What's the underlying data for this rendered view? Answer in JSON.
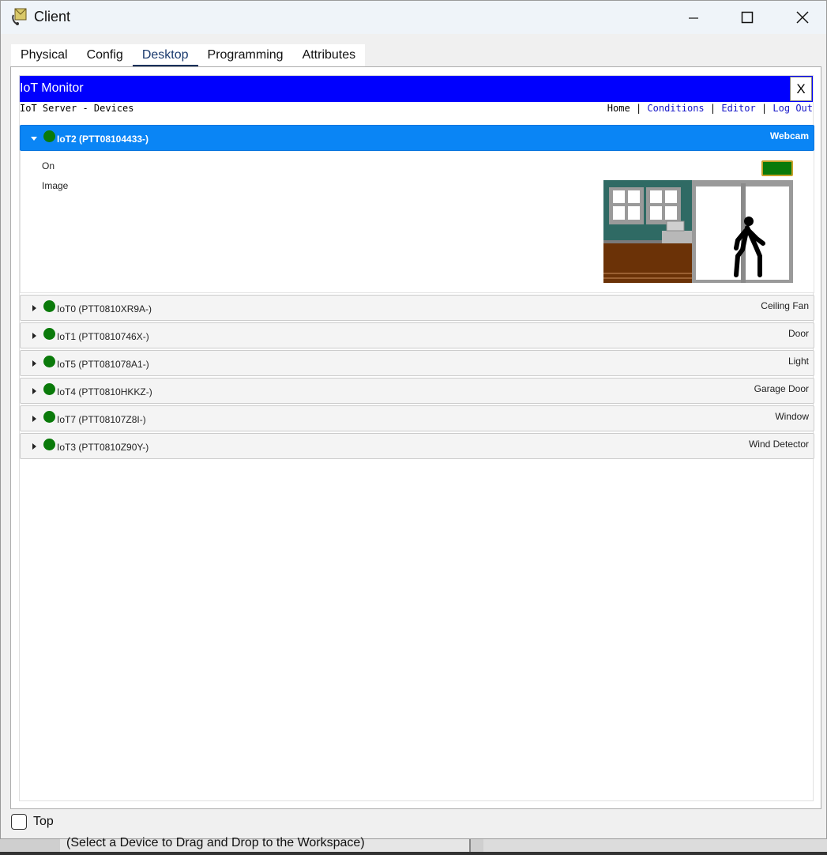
{
  "window": {
    "title": "Client"
  },
  "tabs": [
    {
      "label": "Physical"
    },
    {
      "label": "Config"
    },
    {
      "label": "Desktop",
      "active": true
    },
    {
      "label": "Programming"
    },
    {
      "label": "Attributes"
    }
  ],
  "iot_monitor": {
    "title": "IoT Monitor",
    "close_label": "X",
    "subtitle": "IoT Server - Devices",
    "nav": {
      "home": "Home",
      "conditions": "Conditions",
      "editor": "Editor",
      "logout": "Log Out",
      "sep": "|"
    }
  },
  "expanded_device": {
    "name": "IoT2 (PTT08104433-)",
    "type": "Webcam",
    "status_color": "#0a7a0a",
    "fields": [
      {
        "label": "On"
      },
      {
        "label": "Image"
      }
    ],
    "on_state": true
  },
  "devices": [
    {
      "name": "IoT0 (PTT0810XR9A-)",
      "type": "Ceiling Fan"
    },
    {
      "name": "IoT1 (PTT0810746X-)",
      "type": "Door"
    },
    {
      "name": "IoT5 (PTT081078A1-)",
      "type": "Light"
    },
    {
      "name": "IoT4 (PTT0810HKKZ-)",
      "type": "Garage Door"
    },
    {
      "name": "IoT7 (PTT08107Z8I-)",
      "type": "Window"
    },
    {
      "name": "IoT3 (PTT0810Z90Y-)",
      "type": "Wind Detector"
    }
  ],
  "bottom": {
    "top_label": "Top",
    "top_checked": false
  },
  "status": {
    "text": "(Select a Device to Drag and Drop to the Workspace)"
  },
  "colors": {
    "header_blue": "#0000fe",
    "expanded_row": "#0a85f5",
    "status_green": "#0a7a0a"
  }
}
